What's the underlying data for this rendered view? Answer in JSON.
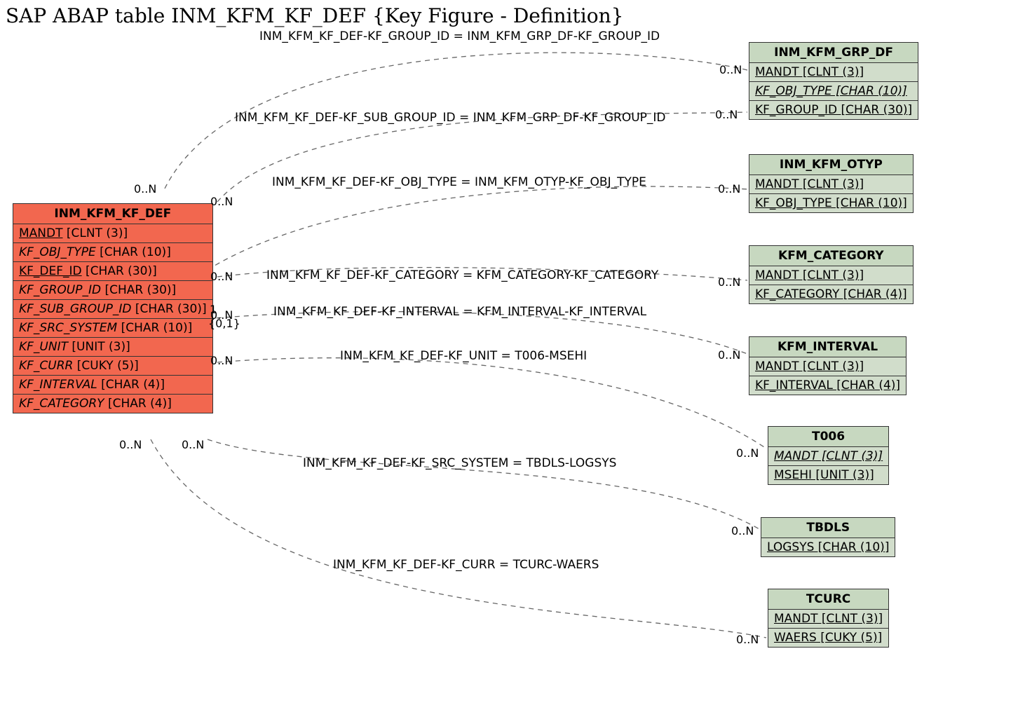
{
  "title": "SAP ABAP table INM_KFM_KF_DEF {Key Figure - Definition}",
  "main_table": {
    "name": "INM_KFM_KF_DEF",
    "fields": {
      "f0": {
        "name": "MANDT",
        "type": "CLNT (3)",
        "key": true
      },
      "f1": {
        "name": "KF_OBJ_TYPE",
        "type": "CHAR (10)",
        "italic": true
      },
      "f2": {
        "name": "KF_DEF_ID",
        "type": "CHAR (30)",
        "key": true
      },
      "f3": {
        "name": "KF_GROUP_ID",
        "type": "CHAR (30)",
        "italic": true
      },
      "f4": {
        "name": "KF_SUB_GROUP_ID",
        "type": "CHAR (30)",
        "italic": true
      },
      "f5": {
        "name": "KF_SRC_SYSTEM",
        "type": "CHAR (10)",
        "italic": true
      },
      "f6": {
        "name": "KF_UNIT",
        "type": "UNIT (3)",
        "italic": true
      },
      "f7": {
        "name": "KF_CURR",
        "type": "CUKY (5)",
        "italic": true
      },
      "f8": {
        "name": "KF_INTERVAL",
        "type": "CHAR (4)",
        "italic": true
      },
      "f9": {
        "name": "KF_CATEGORY",
        "type": "CHAR (4)",
        "italic": true
      }
    }
  },
  "ref_tables": {
    "grpdf": {
      "name": "INM_KFM_GRP_DF",
      "f0": {
        "text": "MANDT [CLNT (3)]",
        "u": true
      },
      "f1": {
        "text": "KF_OBJ_TYPE [CHAR (10)]",
        "u": true,
        "i": true
      },
      "f2": {
        "text": "KF_GROUP_ID [CHAR (30)]",
        "u": true
      }
    },
    "otyp": {
      "name": "INM_KFM_OTYP",
      "f0": {
        "text": "MANDT [CLNT (3)]",
        "u": true
      },
      "f1": {
        "text": "KF_OBJ_TYPE [CHAR (10)]",
        "u": true
      }
    },
    "cat": {
      "name": "KFM_CATEGORY",
      "f0": {
        "text": "MANDT [CLNT (3)]",
        "u": true
      },
      "f1": {
        "text": "KF_CATEGORY [CHAR (4)]",
        "u": true
      }
    },
    "intv": {
      "name": "KFM_INTERVAL",
      "f0": {
        "text": "MANDT [CLNT (3)]",
        "u": true
      },
      "f1": {
        "text": "KF_INTERVAL [CHAR (4)]",
        "u": true
      }
    },
    "t006": {
      "name": "T006",
      "f0": {
        "text": "MANDT [CLNT (3)]",
        "u": true,
        "i": true
      },
      "f1": {
        "text": "MSEHI [UNIT (3)]",
        "u": true
      }
    },
    "tbdls": {
      "name": "TBDLS",
      "f0": {
        "text": "LOGSYS [CHAR (10)]",
        "u": true
      }
    },
    "tcurc": {
      "name": "TCURC",
      "f0": {
        "text": "MANDT [CLNT (3)]",
        "u": true
      },
      "f1": {
        "text": "WAERS [CUKY (5)]",
        "u": true
      }
    }
  },
  "edge_labels": {
    "e1": "INM_KFM_KF_DEF-KF_GROUP_ID = INM_KFM_GRP_DF-KF_GROUP_ID",
    "e2": "INM_KFM_KF_DEF-KF_SUB_GROUP_ID = INM_KFM_GRP_DF-KF_GROUP_ID",
    "e3": "INM_KFM_KF_DEF-KF_OBJ_TYPE = INM_KFM_OTYP-KF_OBJ_TYPE",
    "e4": "INM_KFM_KF_DEF-KF_CATEGORY = KFM_CATEGORY-KF_CATEGORY",
    "e5": "INM_KFM_KF_DEF-KF_INTERVAL = KFM_INTERVAL-KF_INTERVAL",
    "e6": "INM_KFM_KF_DEF-KF_UNIT = T006-MSEHI",
    "e7": "INM_KFM_KF_DEF-KF_SRC_SYSTEM = TBDLS-LOGSYS",
    "e8": "INM_KFM_KF_DEF-KF_CURR = TCURC-WAERS"
  },
  "cardinalities": {
    "c1_left": "0..N",
    "c1_right": "0..N",
    "c2_left": "0..N",
    "c2_right": "0..N",
    "c3_left": "0..N",
    "c3_right": "0..N",
    "c4_left": "0..N",
    "c4_right": "0..N",
    "c5_left": "1",
    "c5_left2": "{0,1}",
    "c5_right": "0..N",
    "c6_left": "0..N",
    "c6_right": "0..N",
    "c7_left": "0..N",
    "c7_right": "0..N",
    "c8_left": "0..N",
    "c8_right": "0..N"
  }
}
